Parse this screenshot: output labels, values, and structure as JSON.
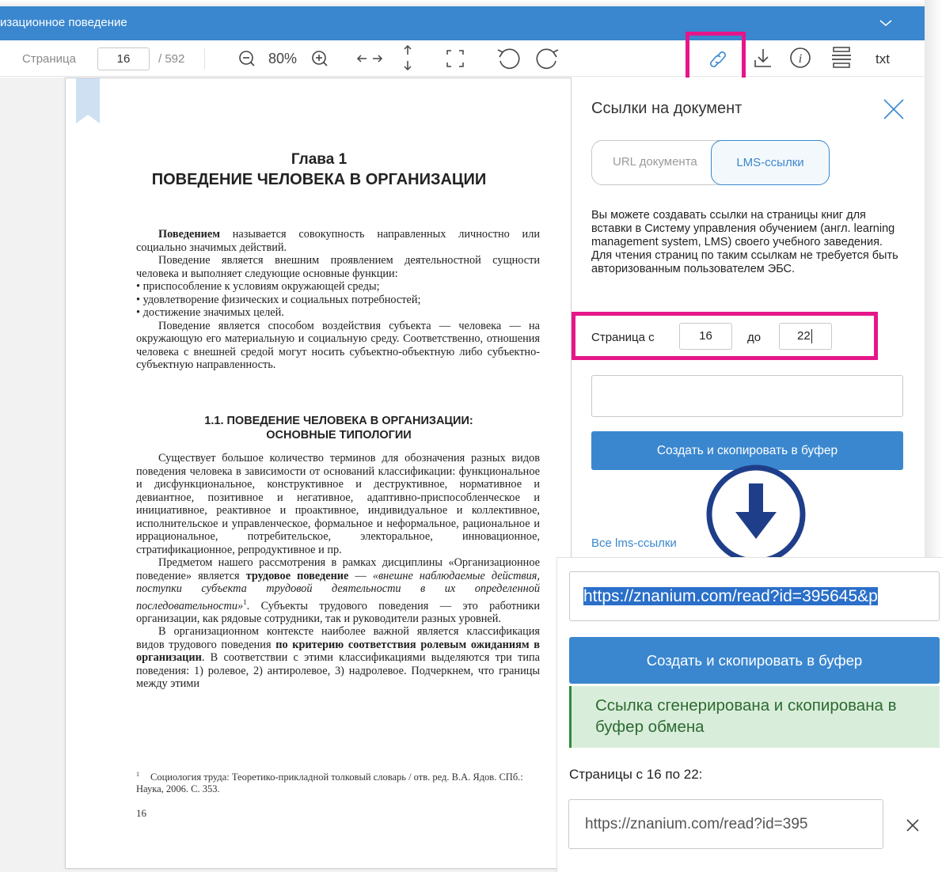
{
  "window": {
    "title": "изационное поведение"
  },
  "toolbar": {
    "page_label": "Страница",
    "current_page": "16",
    "total_pages": "/ 592",
    "zoom": "80%",
    "txt_label": "txt"
  },
  "document": {
    "chapter": "Глава 1",
    "chapter_title": "ПОВЕДЕНИЕ ЧЕЛОВЕКА В ОРГАНИЗАЦИИ",
    "p1_bold": "Поведением",
    "p1_rest": " называется совокупность направленных личностно или социально значимых действий.",
    "p2": "Поведение является внешним проявлением деятельностной сущности человека и выполняет следующие основные функции:",
    "bullets": [
      "• приспособление к условиям окружающей среды;",
      "• удовлетворение физических и социальных потребностей;",
      "• достижение значимых целей."
    ],
    "p3": "Поведение является способом воздействия субъекта — человека — на окружающую его материальную и социальную среду. Соответственно, отношения человека с внешней средой могут носить субъектно-объектную либо субъектно-субъектную направленность.",
    "section_title_1": "1.1. ПОВЕДЕНИЕ ЧЕЛОВЕКА В ОРГАНИЗАЦИИ:",
    "section_title_2": "ОСНОВНЫЕ ТИПОЛОГИИ",
    "p4": "Существует большое количество терминов для обозначения разных видов поведения человека в зависимости от оснований классификации: функциональное и дисфункциональное, конструктивное и деструктивное, нормативное и девиантное, позитивное и негативное, адаптивно-приспособленческое и инициативное, реактивное и проактивное, индивидуальное и коллективное, исполнительское и управленческое, формальное и неформальное, рациональное и иррациональное, потребительское, электоральное, инновационное, стратификационное, репродуктивное и пр.",
    "p5_a": "Предметом нашего рассмотрения в рамках дисциплины «Организационное поведение» является ",
    "p5_bold": "трудовое поведение",
    "p5_b": " — ",
    "p5_ital": "«внешне наблюдаемые действия, поступки субъекта трудовой деятельности в их определенной последовательности»",
    "p5_sup": "1",
    "p5_c": ". Субъекты трудового поведения — это работники организации, как рядовые сотрудники, так и руководители разных уровней.",
    "p6_a": "В организационном контексте наиболее важной является классификация видов трудового поведения ",
    "p6_bold": "по критерию соответствия ролевым ожиданиям в организации",
    "p6_b": ". В соответствии с этими классификациями выделяются три типа поведения: 1) ролевое, 2) антиролевое, 3) надролевое. Подчеркнем, что границы между этими",
    "footnote_mark": "1",
    "footnote": "Социология труда: Теоретико-прикладной толковый словарь / отв. ред. В.А. Ядов. СПб.: Наука, 2006. С. 353.",
    "page_number": "16"
  },
  "panel": {
    "title": "Ссылки на документ",
    "tab_url": "URL документа",
    "tab_lms": "LMS-ссылки",
    "description": "Вы можете создавать ссылки на страницы книг для вставки в Систему управления обучением (англ. learning management system, LMS) своего учебного заведения. Для чтения страниц по таким ссылкам не требуется быть авторизованным пользователем ЭБС.",
    "range_from_label": "Страница с",
    "range_from": "16",
    "range_to_label": "до",
    "range_to": "22",
    "url_value": "",
    "create_button": "Создать и скопировать в буфер",
    "all_lms_link": "Все lms-ссылки"
  },
  "result": {
    "url": "https://znanium.com/read?id=395645&p",
    "create_button": "Создать и скопировать в буфер",
    "success": "Ссылка сгенерирована и скопирована в буфер обмена",
    "pages_label": "Страницы с 16 по 22:",
    "saved_url": "https://znanium.com/read?id=395"
  },
  "colors": {
    "primary": "#3a87cf",
    "highlight": "#e6168a",
    "success_bg": "#d9eeda",
    "arrow_navy": "#1f3e8a"
  },
  "icons": [
    "chevron-down-icon",
    "zoom-out-icon",
    "zoom-in-icon",
    "fit-width-icon",
    "fit-height-icon",
    "fullscreen-icon",
    "rotate-left-icon",
    "rotate-right-icon",
    "link-icon",
    "download-icon",
    "info-icon",
    "text-layers-icon",
    "bookmark-icon",
    "close-icon",
    "arrow-down-circle-icon"
  ]
}
